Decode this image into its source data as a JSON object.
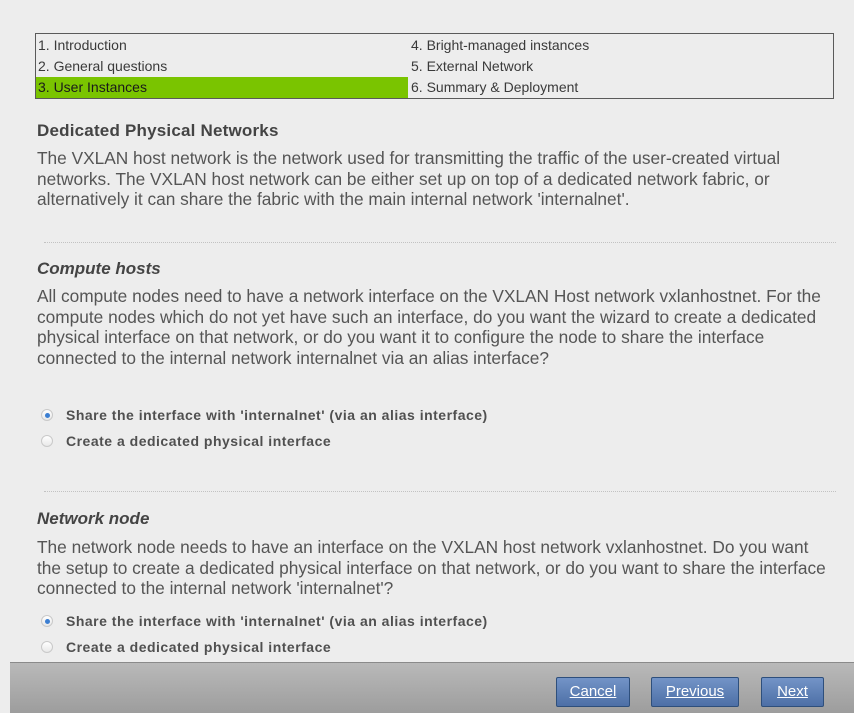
{
  "steps": [
    {
      "label": "1. Introduction",
      "active": false
    },
    {
      "label": "2. General questions",
      "active": false
    },
    {
      "label": "3. User Instances",
      "active": true
    },
    {
      "label": "4. Bright-managed instances",
      "active": false
    },
    {
      "label": "5. External Network",
      "active": false
    },
    {
      "label": "6. Summary & Deployment",
      "active": false
    }
  ],
  "main": {
    "title": "Dedicated Physical Networks",
    "intro": "The VXLAN host network is the network used for transmitting the traffic of the user-created virtual networks. The VXLAN host network can be either set up on top of a dedicated network fabric, or alternatively it can share the fabric with the main internal network 'internalnet'.",
    "compute": {
      "heading": "Compute hosts",
      "text": "All compute nodes need to have a network interface on the VXLAN Host network vxlanhostnet. For the compute nodes which do not yet have such an interface, do you want the wizard to create a dedicated physical interface on that network, or do you want it to configure the node to share the interface connected to the internal network internalnet via an alias interface?",
      "options": [
        {
          "label": "Share the interface with 'internalnet' (via an alias interface)",
          "checked": true
        },
        {
          "label": "Create a dedicated physical interface",
          "checked": false
        }
      ]
    },
    "network_node": {
      "heading": "Network node",
      "text": "The network node needs to have an interface on the VXLAN  host network vxlanhostnet. Do you want the setup to create a dedicated physical interface on that network, or do you want to share the interface connected to the internal network 'internalnet'?",
      "options": [
        {
          "label": "Share the interface with 'internalnet' (via an alias interface)",
          "checked": true
        },
        {
          "label": "Create a dedicated physical interface",
          "checked": false
        }
      ]
    }
  },
  "footer": {
    "cancel_label": "Cancel",
    "previous_label": "Previous",
    "next_label": "Next"
  }
}
